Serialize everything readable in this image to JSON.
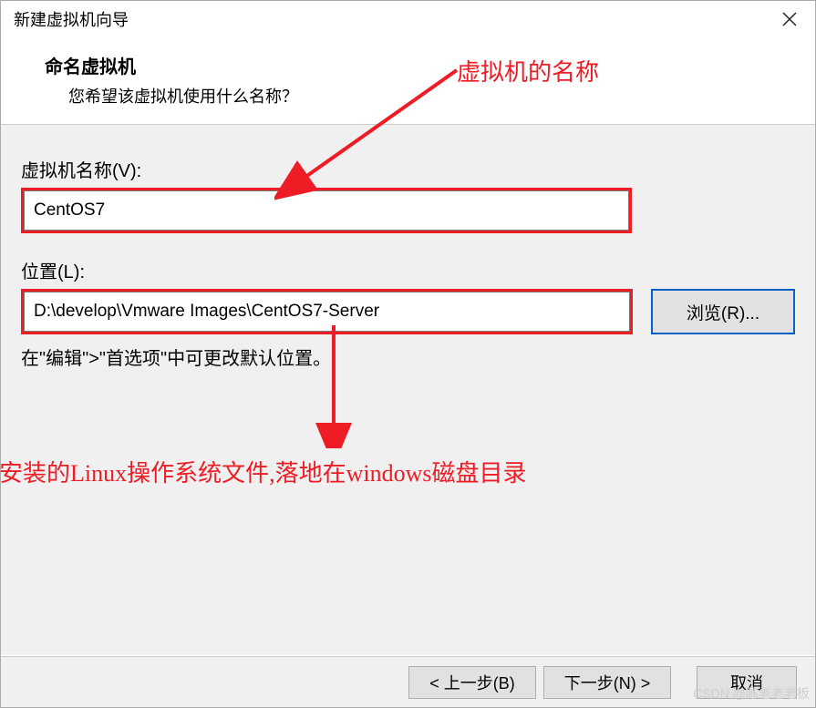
{
  "window": {
    "title": "新建虚拟机向导"
  },
  "header": {
    "title": "命名虚拟机",
    "subtitle": "您希望该虚拟机使用什么名称？"
  },
  "fields": {
    "name_label": "虚拟机名称(V):",
    "name_value": "CentOS7",
    "location_label": "位置(L):",
    "location_value": "D:\\develop\\Vmware Images\\CentOS7-Server",
    "browse_label": "浏览(R)...",
    "note": "在\"编辑\">\"首选项\"中可更改默认位置。"
  },
  "footer": {
    "back": "< 上一步(B)",
    "next": "下一步(N) >",
    "cancel": "取消"
  },
  "annotations": {
    "top": "虚拟机的名称",
    "bottom": "安装的Linux操作系统文件,落地在windows磁盘目录"
  },
  "watermark": "CSDN @陈老老老板"
}
